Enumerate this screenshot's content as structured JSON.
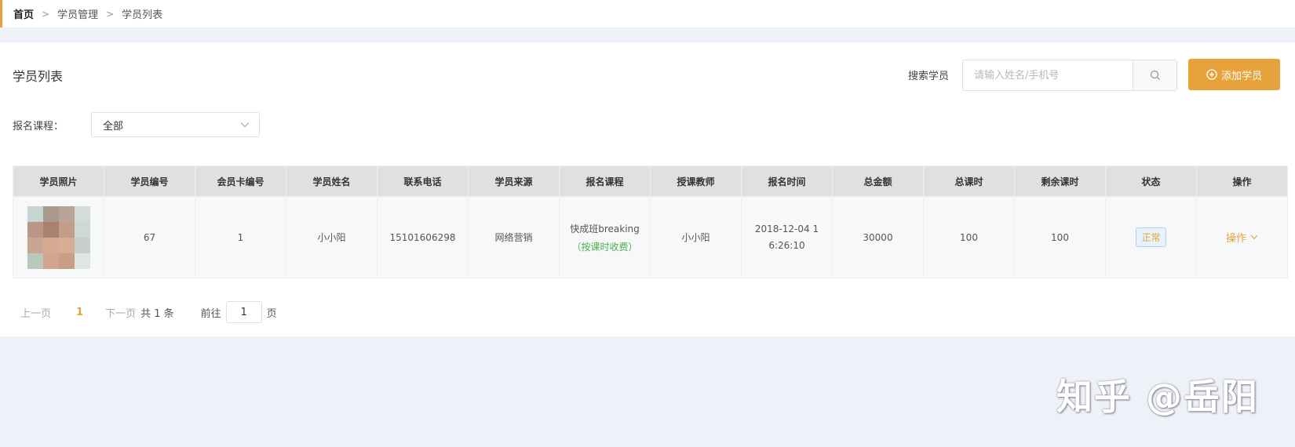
{
  "breadcrumb": [
    "首页",
    "学员管理",
    "学员列表"
  ],
  "panel": {
    "title": "学员列表",
    "search_label": "搜索学员",
    "search_placeholder": "请输入姓名/手机号",
    "add_button": "添加学员"
  },
  "filter": {
    "label": "报名课程：",
    "selected": "全部"
  },
  "table": {
    "columns": [
      "学员照片",
      "学员编号",
      "会员卡编号",
      "学员姓名",
      "联系电话",
      "学员来源",
      "报名课程",
      "授课教师",
      "报名时间",
      "总金额",
      "总课时",
      "剩余课时",
      "状态",
      "操作"
    ],
    "rows": [
      {
        "student_no": "67",
        "card_no": "1",
        "name": "小小阳",
        "phone": "15101606298",
        "source": "网络营销",
        "course": "快成班breaking",
        "course_note": "（按课时收费）",
        "teacher": "小小阳",
        "signup_time": "2018-12-04 16:26:10",
        "total_amount": "30000",
        "total_hours": "100",
        "remaining_hours": "100",
        "status": "正常",
        "action": "操作"
      }
    ]
  },
  "pagination": {
    "prev": "上一页",
    "current": "1",
    "next": "下一页",
    "total": "共 1 条",
    "goto_label": "前往",
    "goto_value": "1",
    "goto_unit": "页"
  },
  "watermark": "知乎 @岳阳",
  "colors": {
    "accent": "#e8a23b",
    "success": "#4cae4c",
    "header_bg": "#e0e0e0",
    "page_bg": "#eef1f8"
  }
}
